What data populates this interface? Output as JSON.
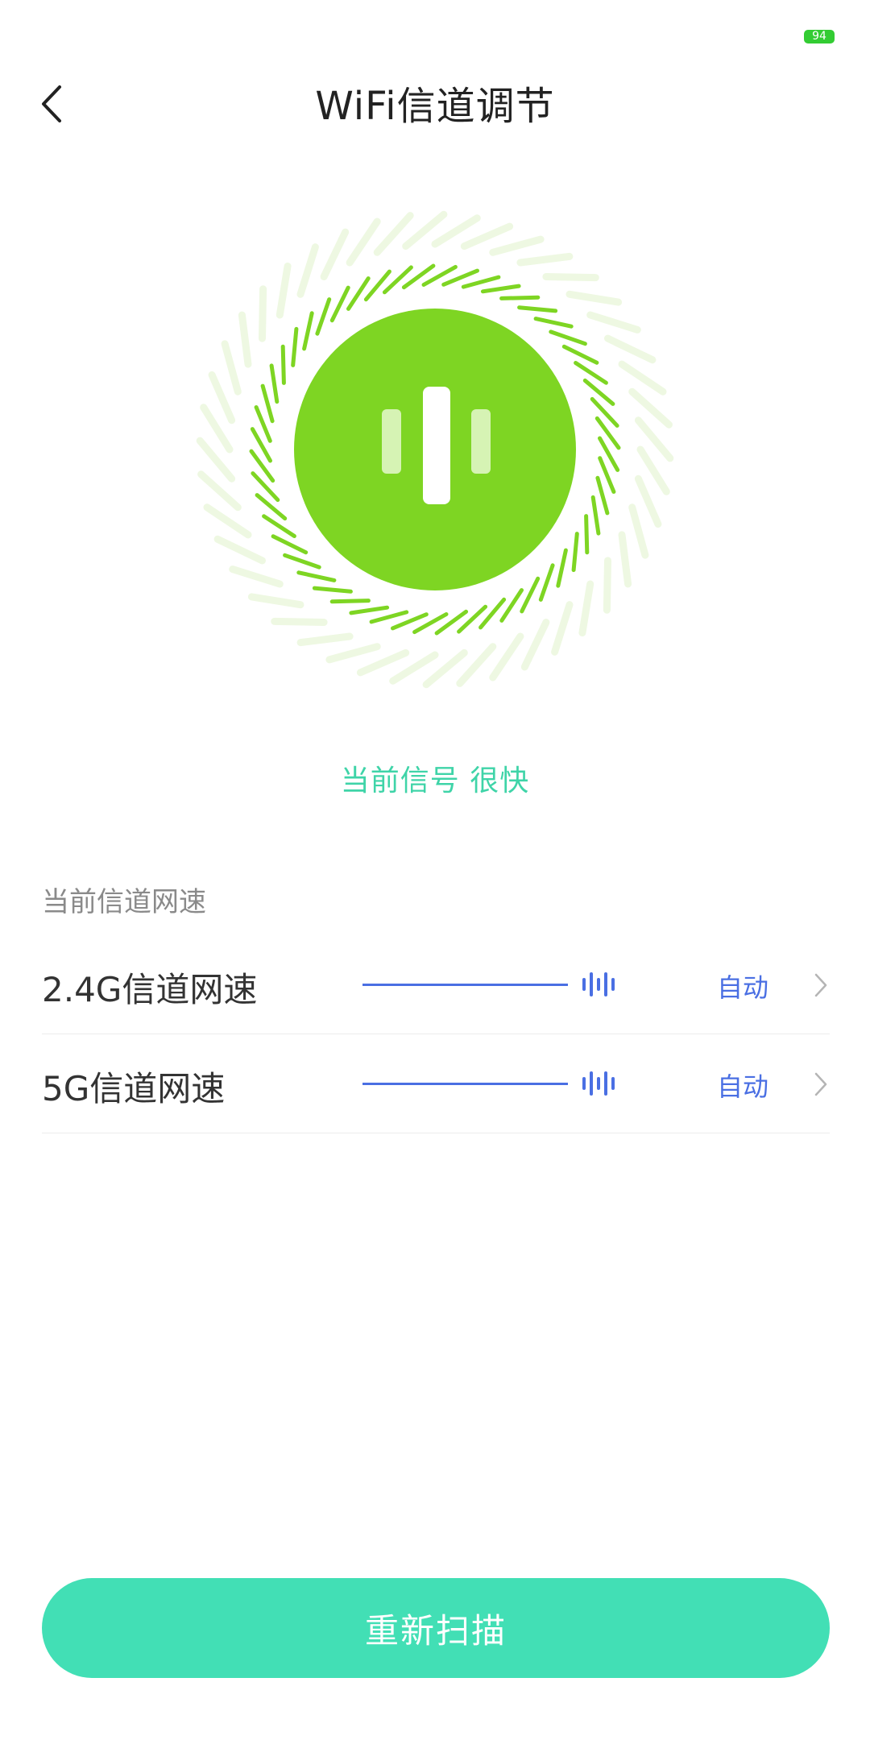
{
  "status_bar": {
    "battery_level": "94"
  },
  "header": {
    "title": "WiFi信道调节"
  },
  "signal": {
    "text": "当前信号 很快"
  },
  "channel_section": {
    "label": "当前信道网速",
    "rows": [
      {
        "label": "2.4G信道网速",
        "value": "自动"
      },
      {
        "label": "5G信道网速",
        "value": "自动"
      }
    ]
  },
  "actions": {
    "rescan_label": "重新扫描"
  },
  "colors": {
    "accent_teal": "#42dfb5",
    "signal_text": "#3fd4a8",
    "hero_green": "#7ed523",
    "hero_green_light": "#eef8e2",
    "channel_blue": "#4a6fe3",
    "battery_green": "#33cc33"
  },
  "icons": {
    "back": "chevron-left-icon",
    "row_arrow": "chevron-right-icon",
    "signal_bars": "signal-bars-icon",
    "hero": "wifi-signal-icon"
  }
}
